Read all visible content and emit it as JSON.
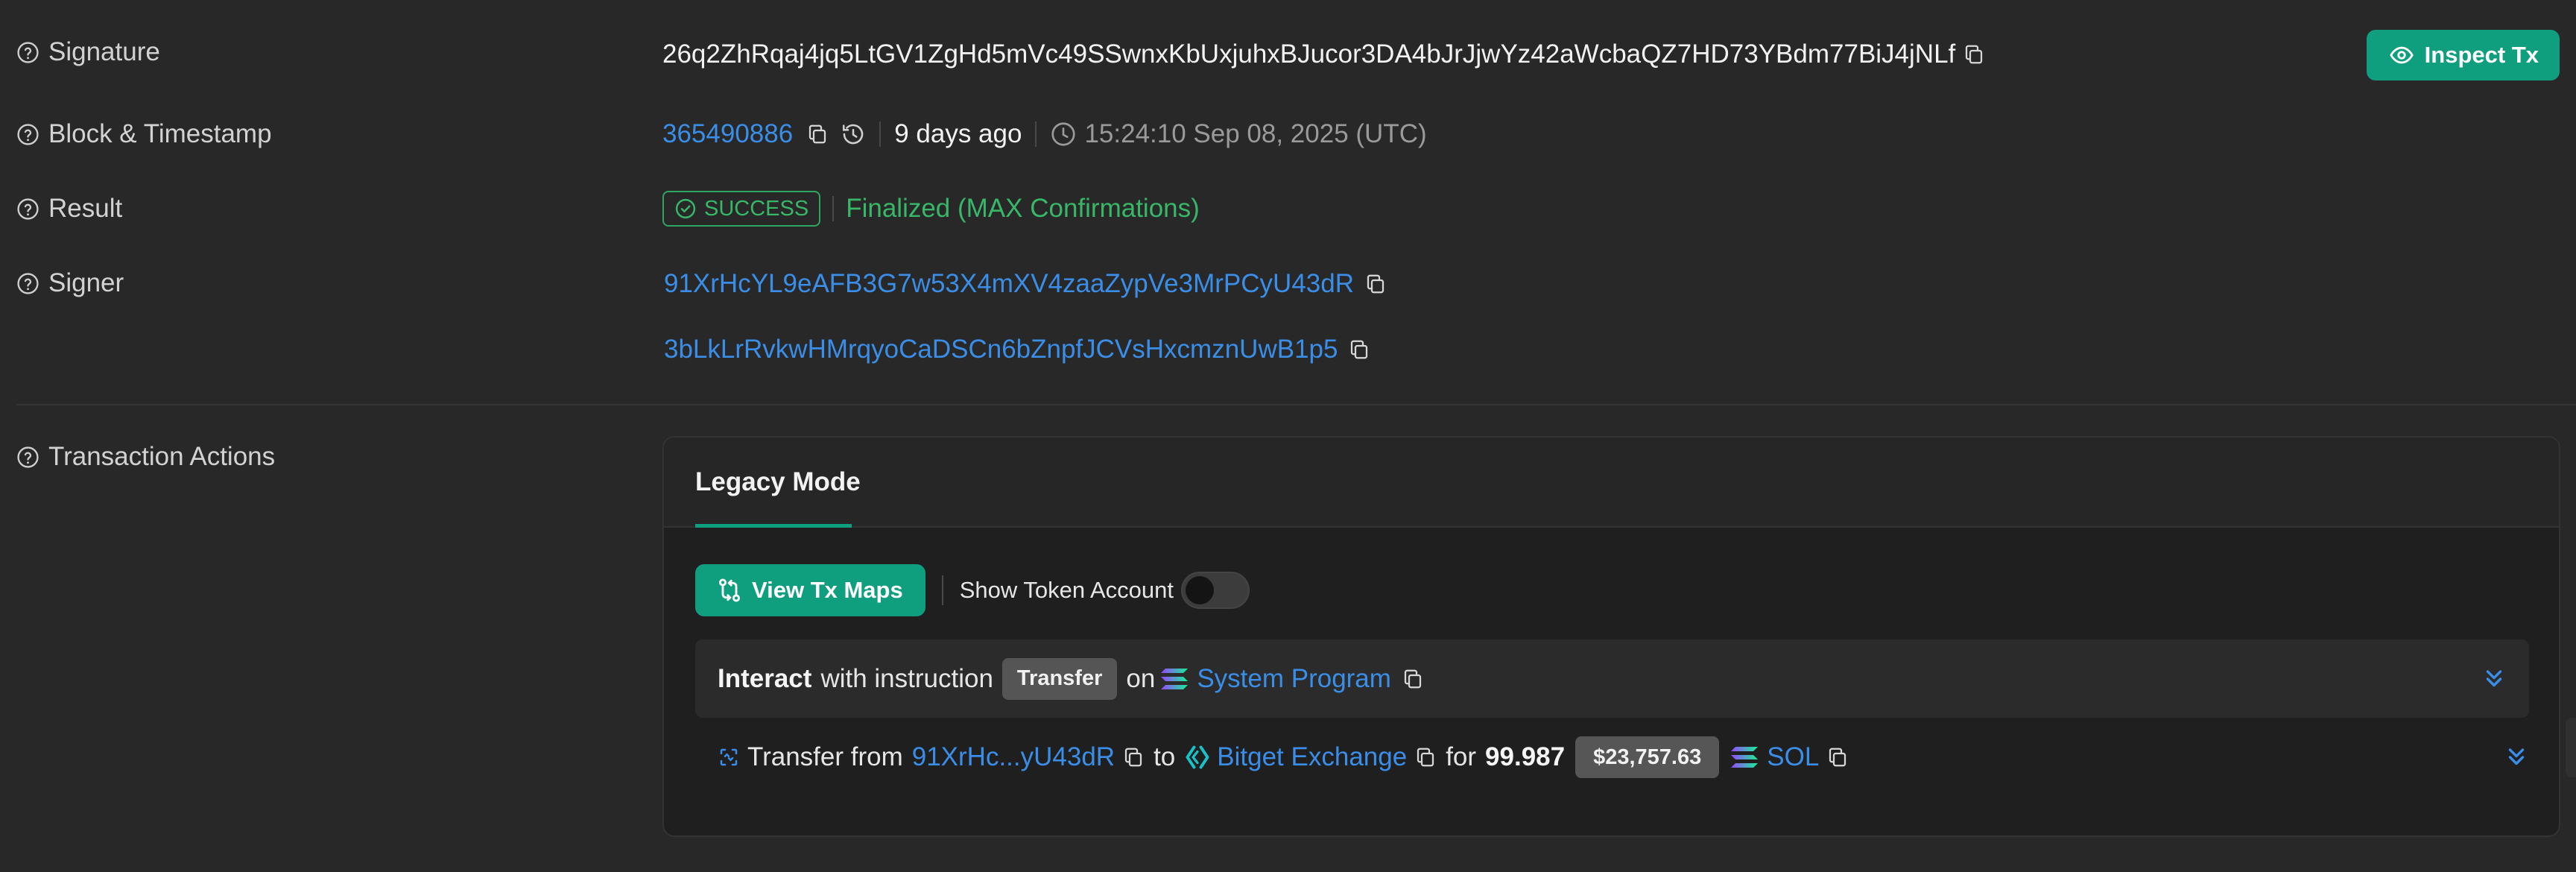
{
  "rows": {
    "signature": {
      "label": "Signature",
      "value": "26q2ZhRqaj4jq5LtGV1ZgHd5mVc49SSwnxKbUxjuhxBJucor3DA4bJrJjwYz42aWcbaQZ7HD73YBdm77BiJ4jNLf"
    },
    "block": {
      "label": "Block & Timestamp",
      "block_number": "365490886",
      "ago": "9 days ago",
      "timestamp": "15:24:10 Sep 08, 2025 (UTC)"
    },
    "result": {
      "label": "Result",
      "status": "SUCCESS",
      "finality": "Finalized (MAX Confirmations)"
    },
    "signer": {
      "label": "Signer",
      "addresses": [
        "91XrHcYL9eAFB3G7w53X4mXV4zaaZypVe3MrPCyU43dR",
        "3bLkLrRvkwHMrqyoCaDSCn6bZnpfJCVsHxcmznUwB1p5"
      ]
    },
    "actions": {
      "label": "Transaction Actions"
    }
  },
  "inspect_button": "Inspect Tx",
  "card": {
    "tab": "Legacy Mode",
    "view_maps_button": "View Tx Maps",
    "show_token_account": "Show Token Account",
    "show_token_account_on": false,
    "instruction": {
      "interact": "Interact",
      "with_instruction": "with instruction",
      "instruction_name": "Transfer",
      "on": "on",
      "program": "System Program"
    },
    "transfer": {
      "prefix": "Transfer from",
      "from": "91XrHc...yU43dR",
      "to_word": "to",
      "to": "Bitget Exchange",
      "for_word": "for",
      "amount": "99.987",
      "usd": "$23,757.63",
      "token": "SOL"
    }
  },
  "colors": {
    "accent": "#0f9f7f",
    "link": "#3a8ee8",
    "success": "#38b768",
    "background": "#282828"
  },
  "icons": [
    "help-circle-icon",
    "copy-icon",
    "eye-icon",
    "history-icon",
    "clock-icon",
    "check-circle-icon",
    "tx-maps-icon",
    "solana-icon",
    "chevrons-down-icon",
    "transfer-icon",
    "exchange-icon"
  ]
}
